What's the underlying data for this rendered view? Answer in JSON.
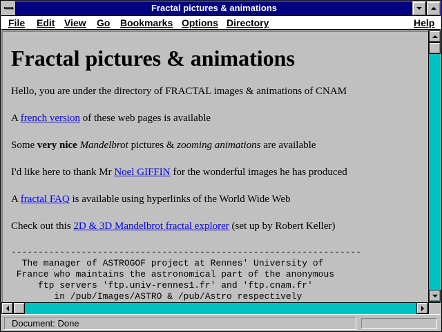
{
  "window": {
    "title": "Fractal pictures & animations"
  },
  "menubar": {
    "items": [
      {
        "label": "File"
      },
      {
        "label": "Edit"
      },
      {
        "label": "View"
      },
      {
        "label": "Go"
      },
      {
        "label": "Bookmarks"
      },
      {
        "label": "Options"
      },
      {
        "label": "Directory"
      },
      {
        "label": "Help"
      }
    ]
  },
  "content": {
    "heading": "Fractal pictures & animations",
    "intro": "Hello, you are under the directory of FRACTAL images & animations of CNAM",
    "french": {
      "pre": "A ",
      "link": "french version",
      "post": " of these web pages is available"
    },
    "mandel": {
      "pre": "Some ",
      "bold": "very nice",
      "mid1": " ",
      "italic1": "Mandelbrot",
      "mid2": " pictures & ",
      "italic2": "zooming animations",
      "post": " are available"
    },
    "thanks": {
      "pre": "I'd like here to thank Mr ",
      "link": "Noel GIFFIN",
      "post": " for the wonderful images he has produced"
    },
    "faq": {
      "pre": "A ",
      "link": "fractal FAQ",
      "post": " is available using hyperlinks of the World Wide Web"
    },
    "explorer": {
      "pre": "Check out this ",
      "link": "2D & 3D Mandelbrot fractal explorer",
      "post": " (set up by Robert Keller)"
    },
    "rule": "-----------------------------------------------------------------",
    "pre_lines": [
      "  The manager of ASTROGOF project at Rennes' University of",
      " France who maintains the astronomical part of the anonymous",
      "     ftp servers 'ftp.univ-rennes1.fr' and 'ftp.cnam.fr'",
      "        in /pub/Images/ASTRO & /pub/Astro respectively"
    ]
  },
  "status": {
    "text": "Document: Done"
  },
  "colors": {
    "titlebar": "#000080",
    "link": "#0000ff",
    "scroll_track": "#00c0c0",
    "background": "#c0c0c0"
  }
}
